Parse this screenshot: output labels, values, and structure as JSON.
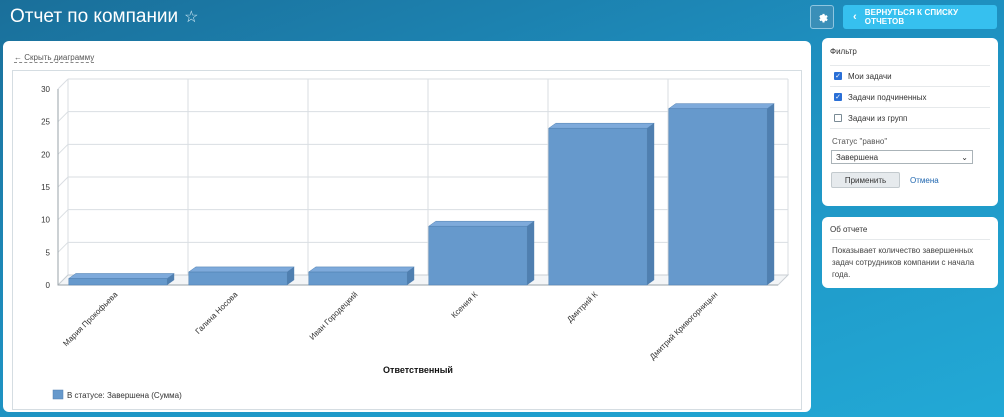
{
  "header": {
    "title": "Отчет по компании",
    "back_label": "ВЕРНУТЬСЯ К СПИСКУ ОТЧЕТОВ"
  },
  "main": {
    "hide_chart_label": "Скрыть диаграмму"
  },
  "chart_data": {
    "type": "bar",
    "categories": [
      "Мария Прокофьева",
      "Галина Носова",
      "Иван Городецкий",
      "Ксения К",
      "Дмитрий К",
      "Дмитрий Кривогорницын"
    ],
    "series": [
      {
        "name": "В статусе: Завершена (Сумма)",
        "values": [
          1,
          2,
          2,
          9,
          24,
          27
        ]
      }
    ],
    "xlabel": "Ответственный",
    "ylabel": "",
    "ylim": [
      0,
      30
    ],
    "yticks": [
      0,
      5,
      10,
      15,
      20,
      25,
      30
    ],
    "grid": true,
    "legend_position": "bottom-left",
    "bar_color": "#6699cc"
  },
  "filter": {
    "title": "Фильтр",
    "options": [
      {
        "label": "Мои задачи",
        "checked": true
      },
      {
        "label": "Задачи подчиненных",
        "checked": true
      },
      {
        "label": "Задачи из групп",
        "checked": false
      }
    ],
    "status_label": "Статус \"равно\"",
    "status_value": "Завершена",
    "apply_label": "Применить",
    "cancel_label": "Отмена"
  },
  "about": {
    "title": "Об отчете",
    "text": "Показывает количество завершенных задач сотрудников компании с начала года."
  }
}
